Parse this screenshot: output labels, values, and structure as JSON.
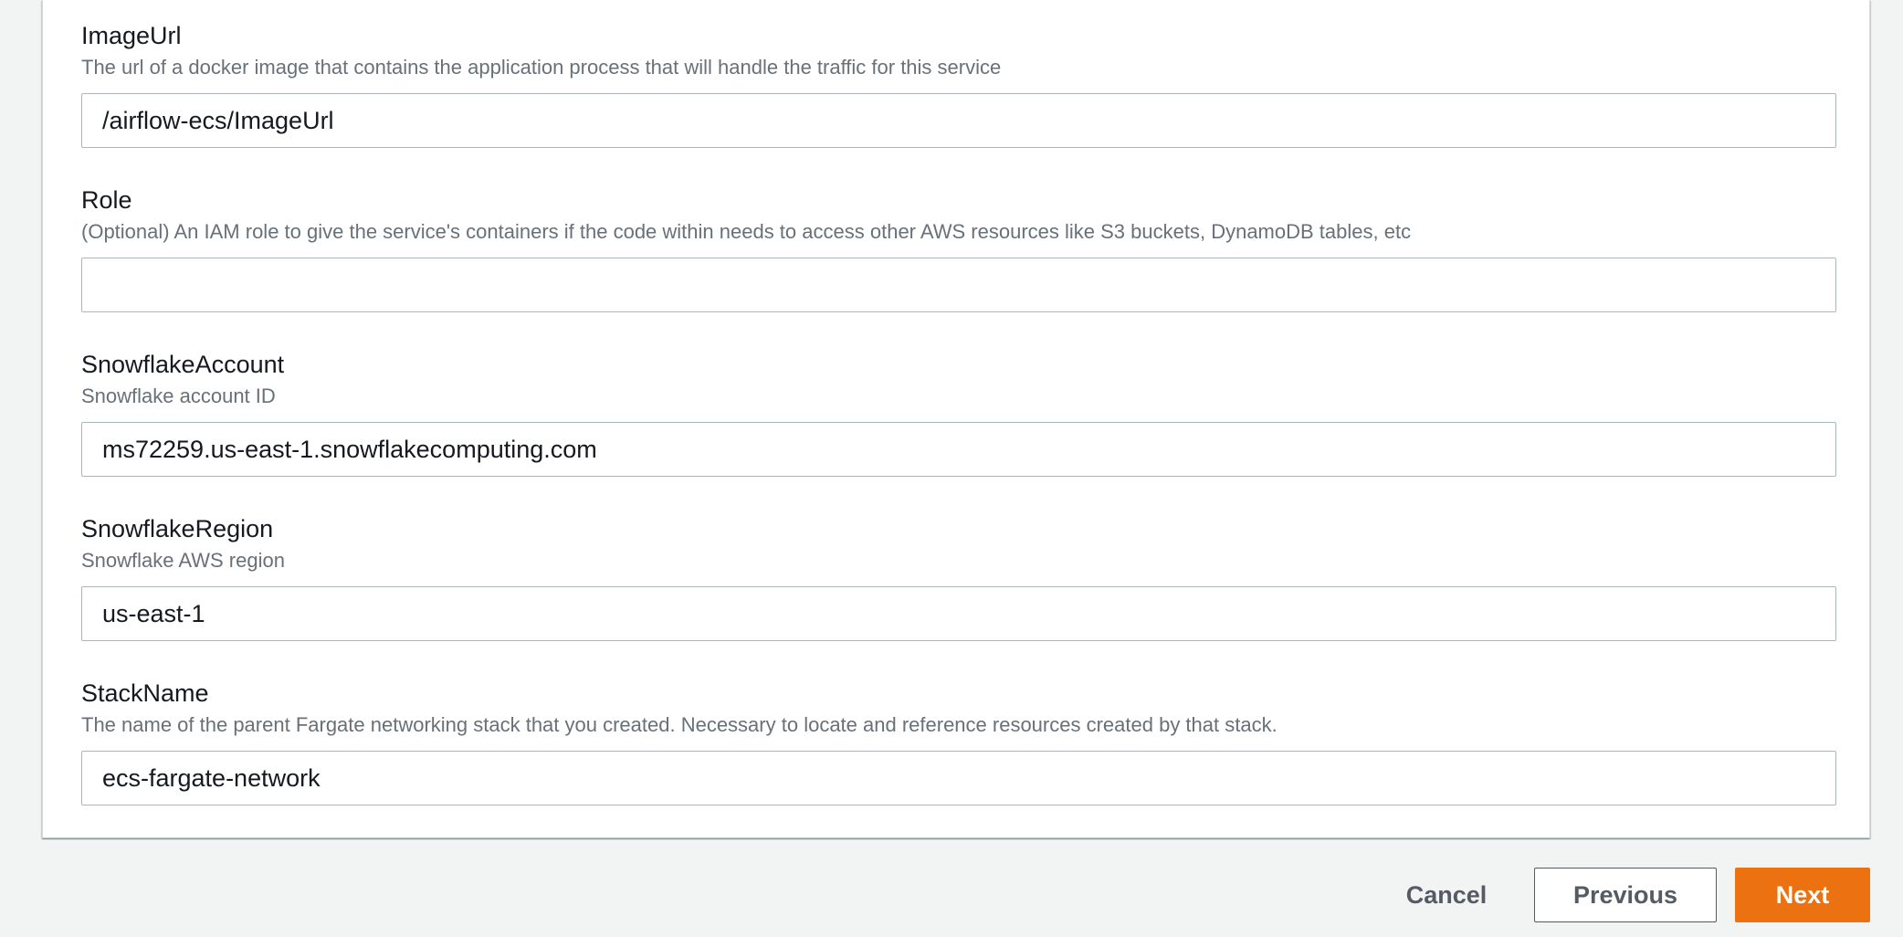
{
  "fields": [
    {
      "label": "ImageUrl",
      "description": "The url of a docker image that contains the application process that will handle the traffic for this service",
      "value": "/airflow-ecs/ImageUrl"
    },
    {
      "label": "Role",
      "description": "(Optional) An IAM role to give the service's containers if the code within needs to access other AWS resources like S3 buckets, DynamoDB tables, etc",
      "value": ""
    },
    {
      "label": "SnowflakeAccount",
      "description": "Snowflake account ID",
      "value": "ms72259.us-east-1.snowflakecomputing.com"
    },
    {
      "label": "SnowflakeRegion",
      "description": "Snowflake AWS region",
      "value": "us-east-1"
    },
    {
      "label": "StackName",
      "description": "The name of the parent Fargate networking stack that you created. Necessary to locate and reference resources created by that stack.",
      "value": "ecs-fargate-network"
    }
  ],
  "actions": {
    "cancel_label": "Cancel",
    "previous_label": "Previous",
    "next_label": "Next"
  },
  "colors": {
    "primary": "#ec7211",
    "text": "#16191f",
    "muted": "#687078",
    "border": "#aab7b8",
    "background": "#f2f3f3"
  }
}
